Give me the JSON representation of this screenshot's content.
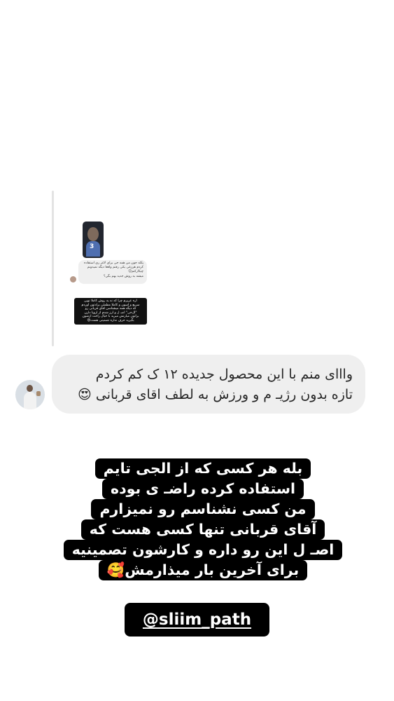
{
  "reply_thread": {
    "thumbnail_number": "3",
    "quoted_message": [
      "یکئه جون من همه جی برای لاغر ری استفاده",
      "کردم هرزغی یکی رفتم واقعا دیگه نمیدونم",
      "چیکارکنم😔",
      "میشه به روش جدید بهم بگی؟"
    ],
    "reply_message": [
      "اره عزیزم چرا که نه یه روش کاملا نوین",
      "سریع و اسون و کاملا مطمئن برادتون اوردم",
      "که دیگه همه میشناسن اقای قربانی رو",
      "\"ال‌جی\" اصـ ل و ارز شدم از اروپا دارن",
      "براتون میارنش میرید با خیال راحت ازشون",
      "بگیرید حرف نداره تضمینی هست😍"
    ]
  },
  "comment": {
    "lines": [
      "وااای منم با این محصول جدیده ۱۲ ک کم کردم",
      "تازه بدون رژیـ م و ورزش به لطف اقای قربانی 😍"
    ]
  },
  "caption": {
    "lines": [
      "بله هر کسی که از الجی تایم",
      "استفاده کرده راضـ ی بوده",
      "من کسی نشناسم رو نمیزارم",
      "آقای قربانی تنها کسی هست که",
      "اصـ ل این رو داره و کارشون تصمینیه",
      "برای آخرین بار میذارمش🥰"
    ]
  },
  "mention": "@sliim_path"
}
